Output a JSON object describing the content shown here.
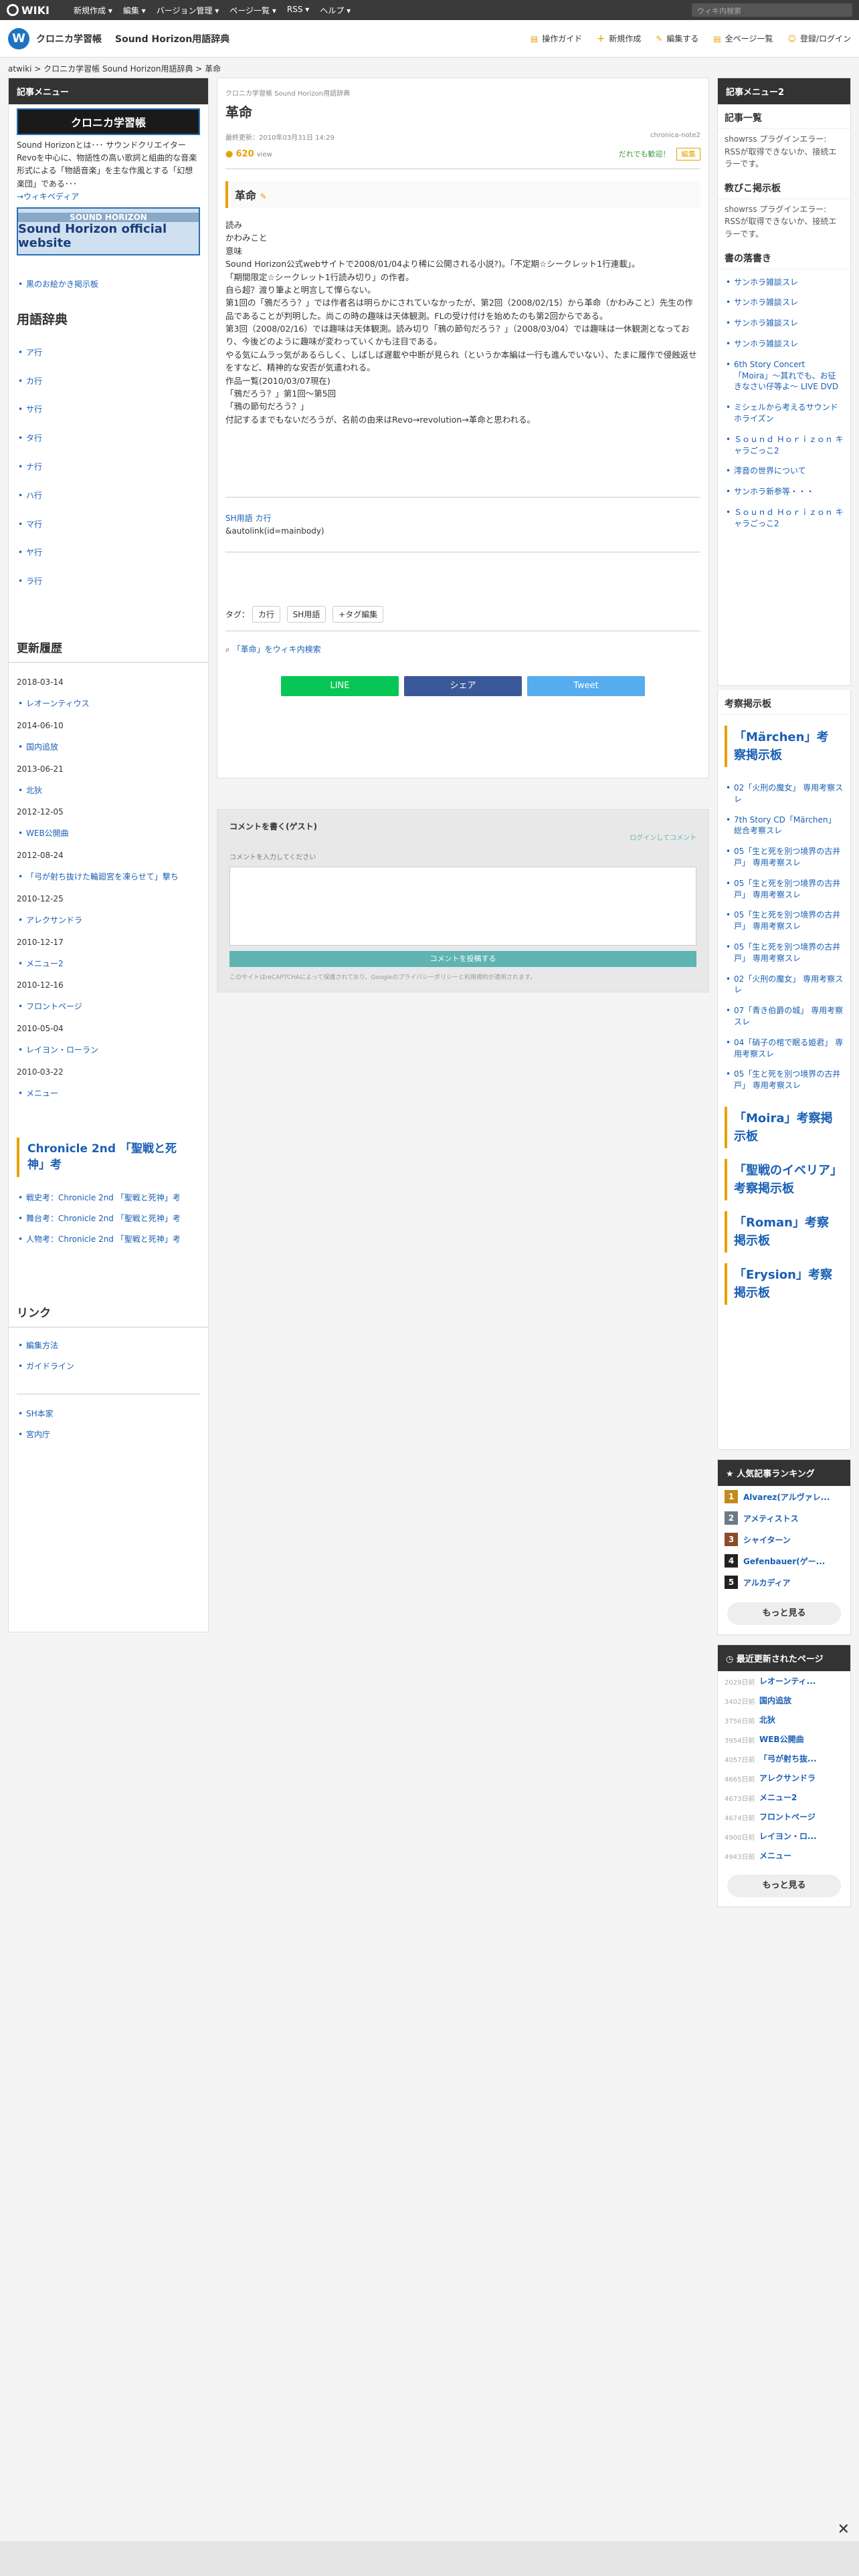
{
  "top": {
    "logo": "WIKI",
    "menu": [
      "新規作成 ▾",
      "編集 ▾",
      "バージョン管理 ▾",
      "ページ一覧 ▾",
      "RSS ▾",
      "ヘルプ ▾"
    ],
    "search_placeholder": "ウィキ内検索"
  },
  "site": {
    "title1": "クロニカ学習帳",
    "title2": "Sound Horizon用語辞典",
    "actions": [
      "操作ガイド",
      "新規作成",
      "編集する",
      "全ページ一覧",
      "登録/ログイン"
    ]
  },
  "breadcrumb": "atwiki > クロニカ学習帳 Sound Horizon用語辞典 > 革命",
  "left": {
    "menu_title": "記事メニュー",
    "banner1": "クロニカ学習帳",
    "intro": "Sound Horizonとは･･･ サウンドクリエイターRevoを中心に、物語性の高い歌詞と組曲的な音楽形式による「物語音楽」を主な作風とする「幻想楽団」である･･･",
    "wiki_link": "→ウィキペディア",
    "banner2_top": "SOUND HORIZON",
    "banner2_main": "Sound Horizon official website",
    "bbs": "黒のお絵かき掲示板",
    "dict_title": "用語辞典",
    "dict": [
      "ア行",
      "カ行",
      "サ行",
      "タ行",
      "ナ行",
      "ハ行",
      "マ行",
      "ヤ行",
      "ラ行"
    ],
    "history_title": "更新履歴",
    "history": [
      {
        "date": "2018-03-14",
        "items": [
          "レオーンティウス"
        ]
      },
      {
        "date": "2014-06-10",
        "items": [
          "国内追放"
        ]
      },
      {
        "date": "2013-06-21",
        "items": [
          "北狄"
        ]
      },
      {
        "date": "2012-12-05",
        "items": [
          "WEB公開曲"
        ]
      },
      {
        "date": "2012-08-24",
        "items": [
          "「弓が射ち抜けた輪廻宮を凍らせて」撃ち"
        ]
      },
      {
        "date": "2010-12-25",
        "items": [
          "アレクサンドラ"
        ]
      },
      {
        "date": "2010-12-17",
        "items": [
          "メニュー2"
        ]
      },
      {
        "date": "2010-12-16",
        "items": [
          "フロントページ"
        ]
      },
      {
        "date": "2010-05-04",
        "items": [
          "レイヨン・ローラン"
        ]
      },
      {
        "date": "2010-03-22",
        "items": [
          "メニュー"
        ]
      }
    ],
    "chronicle_title": "Chronicle 2nd 「聖戦と死神」考",
    "chronicle": [
      "戦史考：Chronicle 2nd 「聖戦と死神」考",
      "舞台考：Chronicle 2nd 「聖戦と死神」考",
      "人物考：Chronicle 2nd 「聖戦と死神」考"
    ],
    "links_title": "リンク",
    "links": [
      "編集方法",
      "ガイドライン"
    ],
    "links2": [
      "SH本家",
      "宮内庁"
    ]
  },
  "article": {
    "crumb": "クロニカ学習帳 Sound Horizon用語辞典",
    "title": "革命",
    "updated": "最終更新：2010年03月31日 14:29",
    "author": "chronica-note2",
    "views": "620",
    "views_unit": "view",
    "welcome": "だれでも歓迎！",
    "edit": "編集",
    "heading": "革命",
    "body": [
      "読み",
      "かわみこと",
      "意味",
      "Sound Horizon公式webサイトで2008/01/04より稀に公開される小説?)。「不定期☆シークレット1行連載」。",
      "「期間限定☆シークレット1行読み切り」の作者。",
      "自ら超？渡り筆よと明言して憚らない。",
      "第1回の「鴉だろう？」では作者名は明らかにされていなかったが、第2回（2008/02/15）から革命（かわみこと）先生の作品であることが判明した。尚この時の趣味は天体観測。FLの受け付けを始めたのも第2回からである。",
      "第3回（2008/02/16）では趣味は天体観測。読み切り「鴉の節句だろう？」（2008/03/04）では趣味は一休観測となっており、今後どのように趣味が変わっていくかも注目である。",
      "やる気にムラっ気があるらしく、しばしば遅載や中断が見られ（というか本編は一行も進んでいない）、たまに履作で侵蝕返せをすなど、精神的な安否が気遣われる。",
      "作品一覧(2010/03/07現在)",
      "「鴉だろう？」第1回〜第5回",
      "「鴉の節句だろう？」",
      "付記するまでもないだろうが、名前の由来はRevo→revolution→革命と思われる。"
    ],
    "category": "SH用語 カ行",
    "autolink": "&autolink(id=mainbody)",
    "tag_label": "タグ：",
    "tags": [
      "カ行",
      "SH用語"
    ],
    "tag_edit": "+タグ編集",
    "search": "「革命」をウィキ内検索",
    "share": [
      "LINE",
      "シェア",
      "Tweet"
    ]
  },
  "comment": {
    "title": "コメントを書く(ゲスト)",
    "link": "ログインしてコメント",
    "label": "コメントを入力してください",
    "submit": "コメントを投稿する",
    "note": "このサイトはreCAPTCHAによって保護されており、Googleのプライバシーポリシーと利用規約が適用されます。"
  },
  "right": {
    "menu_title": "記事メニュー2",
    "kiji_title": "記事一覧",
    "kiji_text": "showrss プラグインエラー: RSSが取得できないか、接続エラーです。",
    "kyoiku_title": "教びこ掲示板",
    "kyoiku_text": "showrss プラグインエラー: RSSが取得できないか、接続エラーです。",
    "shonin_title": "書の落書き",
    "shonin": [
      "サンホラ雑談スレ",
      "サンホラ雑談スレ",
      "サンホラ雑談スレ",
      "サンホラ雑談スレ",
      "6th Story Concert 「Moira」〜其れでも、お征きなさい仔等よ〜 LIVE DVD",
      "ミシェルから考えるサウンドホライズン",
      "Ｓｏｕｎｄ Ｈｏｒｉｚｏｎ キャラごっこ2",
      "澪音の世界について",
      "サンホラ新参等・・・",
      "Ｓｏｕｎｄ Ｈｏｒｉｚｏｎ キャラごっこ2"
    ],
    "kosatsu_title": "考察掲示板",
    "marchen_title": "「Märchen」考察掲示板",
    "marchen": [
      "02「火刑の魔女」 専用考察スレ",
      "7th Story CD「Märchen」総合考察スレ",
      "05「生と死を別つ境界の古井戸」 専用考察スレ",
      "05「生と死を別つ境界の古井戸」 専用考察スレ",
      "05「生と死を別つ境界の古井戸」 専用考察スレ",
      "05「生と死を別つ境界の古井戸」 専用考察スレ",
      "02「火刑の魔女」 専用考察スレ",
      "07「青き伯爵の城」 専用考察スレ",
      "04「硝子の棺で眠る姫君」 専用考察スレ",
      "05「生と死を別つ境界の古井戸」 専用考察スレ"
    ],
    "others": [
      "「Moira」考察掲示板",
      "「聖戦のイベリア」考察掲示板",
      "「Roman」考察掲示板",
      "「Erysion」考察掲示板"
    ],
    "rank_title": "人気記事ランキング",
    "ranks": [
      "Alvarez(アルヴァレ...",
      "アメティストス",
      "シャイターン",
      "Gefenbauer(ゲー...",
      "アルカディア"
    ],
    "more": "もっと見る",
    "recent_title": "最近更新されたページ",
    "recent": [
      {
        "d": "2029日前",
        "t": "レオーンティ..."
      },
      {
        "d": "3402日前",
        "t": "国内追放"
      },
      {
        "d": "3756日前",
        "t": "北狄"
      },
      {
        "d": "3954日前",
        "t": "WEB公開曲"
      },
      {
        "d": "4057日前",
        "t": "「弓が射ち抜..."
      },
      {
        "d": "4665日前",
        "t": "アレクサンドラ"
      },
      {
        "d": "4673日前",
        "t": "メニュー2"
      },
      {
        "d": "4674日前",
        "t": "フロントページ"
      },
      {
        "d": "4900日前",
        "t": "レイヨン・ロ..."
      },
      {
        "d": "4943日前",
        "t": "メニュー"
      }
    ],
    "more2": "もっと見る"
  },
  "colors": {
    "accent": "#e8a200",
    "link": "#1a5fb4",
    "line": "#06c755",
    "fb": "#3b5998",
    "tw": "#55acee"
  }
}
